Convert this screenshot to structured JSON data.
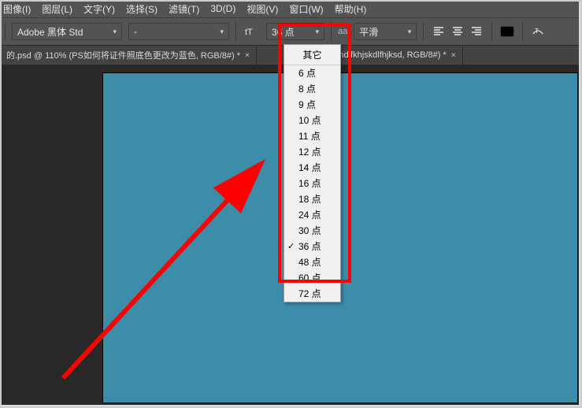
{
  "menu": {
    "items": [
      "图像(I)",
      "图层(L)",
      "文字(Y)",
      "选择(S)",
      "滤镜(T)",
      "3D(D)",
      "视图(V)",
      "窗口(W)",
      "帮助(H)"
    ]
  },
  "opt": {
    "font_family": "Adobe 黑体 Std",
    "font_style": "-",
    "size_value": "36 点",
    "aa_label": "平滑",
    "aa_prefix": "aa"
  },
  "tabs": {
    "a": "的.psd @ 110% (PS如何将证件照底色更改为蓝色, RGB/8#) *",
    "b": "% (ndjfkhjskdlfhjksd, RGB/8#) *"
  },
  "sizes": {
    "header": "其它",
    "options": [
      "6 点",
      "8 点",
      "9 点",
      "10 点",
      "11 点",
      "12 点",
      "14 点",
      "16 点",
      "18 点",
      "24 点",
      "30 点",
      "36 点",
      "48 点",
      "60 点",
      "72 点"
    ],
    "selected": "36 点"
  }
}
